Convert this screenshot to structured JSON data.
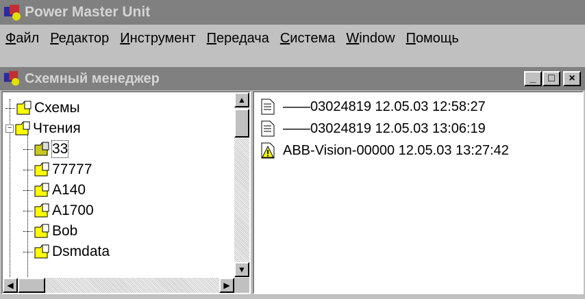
{
  "app": {
    "title": "Power Master Unit"
  },
  "menu": [
    {
      "acc": "Ф",
      "rest": "айл"
    },
    {
      "acc": "Р",
      "rest": "едактор"
    },
    {
      "acc": "И",
      "rest": "нструмент"
    },
    {
      "acc": "П",
      "rest": "ередача"
    },
    {
      "acc": "С",
      "rest": "истема"
    },
    {
      "acc": "W",
      "rest": "indow"
    },
    {
      "acc": "П",
      "rest": "омощь"
    }
  ],
  "child_window": {
    "title": "Схемный менеджер",
    "buttons": {
      "minimize": "_",
      "maximize": "□",
      "close": "×"
    }
  },
  "tree": {
    "items": [
      {
        "label": "Схемы",
        "level": 0
      },
      {
        "label": "Чтения",
        "level": 0
      },
      {
        "label": "33",
        "level": 1
      },
      {
        "label": "77777",
        "level": 1
      },
      {
        "label": "A140",
        "level": 1
      },
      {
        "label": "A1700",
        "level": 1
      },
      {
        "label": "Bob",
        "level": 1
      },
      {
        "label": "Dsmdata",
        "level": 1
      }
    ]
  },
  "files": [
    {
      "label": "——03024819 12.05.03 12:58:27",
      "icon": "document-icon"
    },
    {
      "label": "——03024819 12.05.03 13:06:19",
      "icon": "document-icon"
    },
    {
      "label": "ABB-Vision-00000 12.05.03 13:27:42",
      "icon": "warning-icon"
    }
  ],
  "colors": {
    "titlebar_inactive": "#808080",
    "folder": "#ffff00",
    "face": "#c0c0c0"
  }
}
